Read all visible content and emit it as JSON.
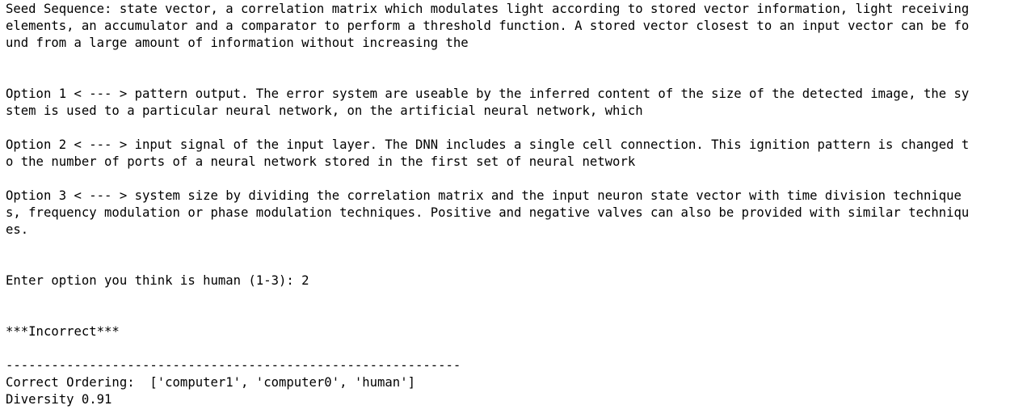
{
  "seed": [
    "Seed Sequence: state vector, a correlation matrix which modulates light according to stored vector information, light receiving",
    "elements, an accumulator and a comparator to perform a threshold function. A stored vector closest to an input vector can be fo",
    "und from a large amount of information without increasing the"
  ],
  "option1": [
    "Option 1 < --- > pattern output. The error system are useable by the inferred content of the size of the detected image, the sy",
    "stem is used to a particular neural network, on the artificial neural network, which"
  ],
  "option2": [
    "Option 2 < --- > input signal of the input layer. The DNN includes a single cell connection. This ignition pattern is changed t",
    "o the number of ports of a neural network stored in the first set of neural network"
  ],
  "option3": [
    "Option 3 < --- > system size by dividing the correlation matrix and the input neuron state vector with time division technique",
    "s, frequency modulation or phase modulation techniques. Positive and negative valves can also be provided with similar techniqu",
    "es."
  ],
  "prompt": "Enter option you think is human (1-3): 2",
  "result": "***Incorrect***",
  "divider": "------------------------------------------------------------",
  "correct_ordering": "Correct Ordering:  ['computer1', 'computer0', 'human']",
  "diversity": "Diversity 0.91"
}
